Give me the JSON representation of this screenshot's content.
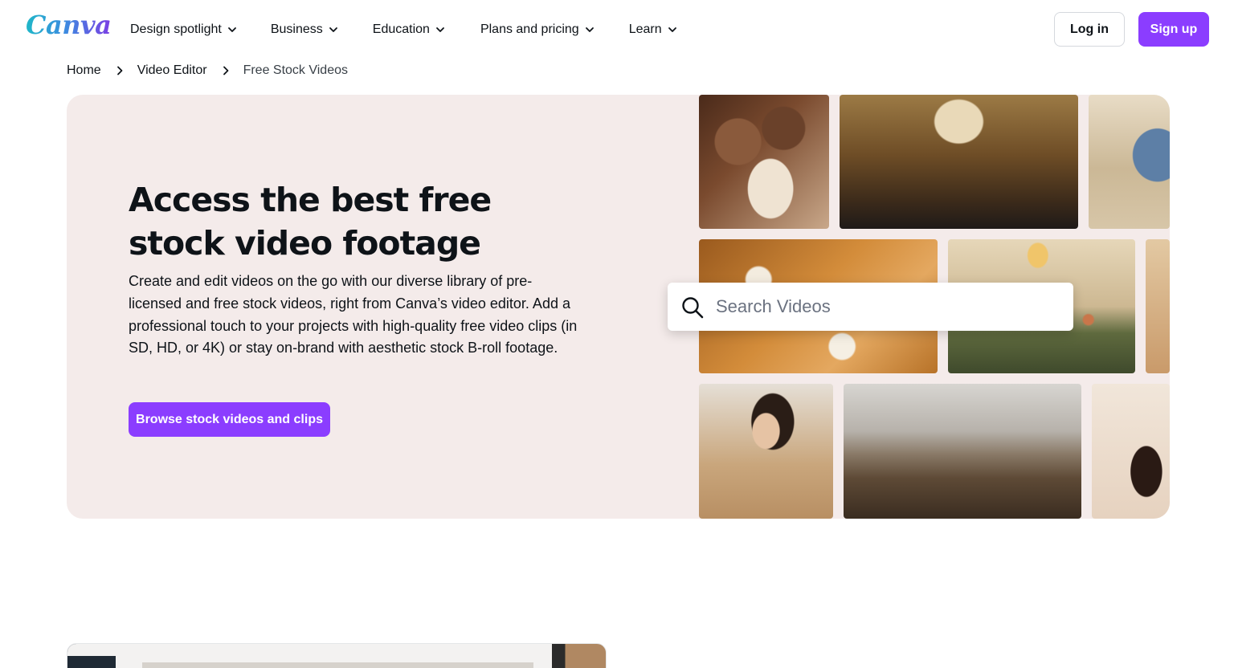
{
  "header": {
    "logo": "Canva",
    "nav": [
      {
        "label": "Design spotlight"
      },
      {
        "label": "Business"
      },
      {
        "label": "Education"
      },
      {
        "label": "Plans and pricing"
      },
      {
        "label": "Learn"
      }
    ],
    "login_label": "Log in",
    "signup_label": "Sign up"
  },
  "breadcrumb": [
    {
      "label": "Home"
    },
    {
      "label": "Video Editor"
    },
    {
      "label": "Free Stock Videos"
    }
  ],
  "hero": {
    "title": "Access the best free stock video footage",
    "description": "Create and edit videos on the go with our diverse library of pre-licensed and free stock videos, right from Canva’s video editor. Add a professional touch to your projects with high-quality free video clips (in SD, HD, or 4K) or stay on-brand with aesthetic stock B-roll footage.",
    "cta_label": "Browse stock videos and clips"
  },
  "search": {
    "placeholder": "Search Videos",
    "value": ""
  },
  "colors": {
    "brand_purple": "#8b3dff",
    "hero_background": "#f4ebea",
    "text": "#0e1318"
  },
  "icons": {
    "search": "search-icon",
    "chevron": "chevron-down-icon",
    "breadcrumb_separator": "chevron-right-icon"
  }
}
